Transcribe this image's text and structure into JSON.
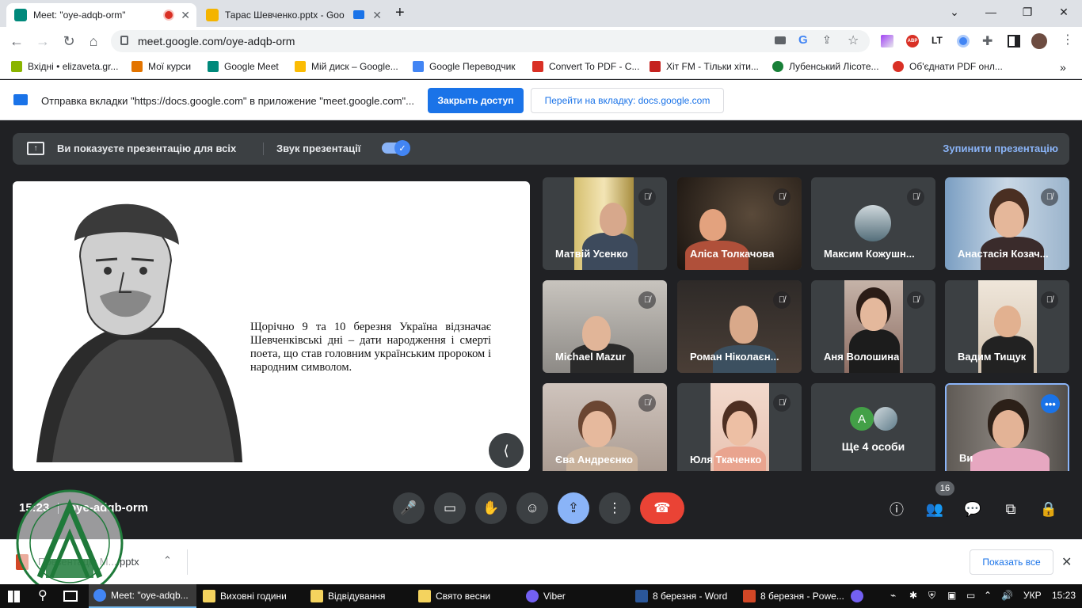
{
  "browser": {
    "tabs": [
      {
        "title": "Meet: \"oye-adqb-orm\"",
        "active": true,
        "fav_color": "#00897b"
      },
      {
        "title": "Тарас Шевченко.pptx - Goo",
        "active": false,
        "fav_color": "#f4b400"
      }
    ],
    "new_tab": "+",
    "url": "meet.google.com/oye-adqb-orm",
    "bookmarks": [
      {
        "label": "Вхідні • elizaveta.gr...",
        "color": "#8ab400"
      },
      {
        "label": "Мої курси",
        "color": "#e37400"
      },
      {
        "label": "Google Meet",
        "color": "#00897b"
      },
      {
        "label": "Мій диск – Google...",
        "color": "#fbbc04"
      },
      {
        "label": "Google Переводчик",
        "color": "#4285f4"
      },
      {
        "label": "Convert To PDF - C...",
        "color": "#d93025"
      },
      {
        "label": "Хіт FM - Тільки хіти...",
        "color": "#c5221f"
      },
      {
        "label": "Лубенський Лісоте...",
        "color": "#188038"
      },
      {
        "label": "Об'єднати PDF онл...",
        "color": "#d93025"
      }
    ],
    "bookmarks_more": "»"
  },
  "infobar": {
    "message": "Отправка вкладки \"https://docs.google.com\" в приложение \"meet.google.com\"...",
    "primary_button": "Закрыть доступ",
    "secondary_button": "Перейти на вкладку: docs.google.com"
  },
  "presenting_bar": {
    "status": "Ви показуєте презентацію для всіх",
    "audio_label": "Звук презентації",
    "stop_label": "Зупинити презентацію"
  },
  "slide": {
    "text": "Щорічно 9 та 10 березня Україна відзначає Шевченківські дні – дати народження і смерті поета, що став головним українським пророком і народним символом."
  },
  "participants": [
    {
      "name": "Матвій Усенко"
    },
    {
      "name": "Аліса Толкачова"
    },
    {
      "name": "Максим Кожушн..."
    },
    {
      "name": "Анастасія Козач..."
    },
    {
      "name": "Michael Mazur"
    },
    {
      "name": "Роман Ніколаєн..."
    },
    {
      "name": "Аня Волошина"
    },
    {
      "name": "Вадим Тищук"
    },
    {
      "name": "Єва Андреєнко"
    },
    {
      "name": "Юля Ткаченко"
    },
    {
      "name": "Ще 4 особи",
      "avatar_letter": "A"
    },
    {
      "name": "Ви"
    }
  ],
  "bottom": {
    "time": "15:23",
    "meeting_code": "oye-adqb-orm",
    "people_count": "16"
  },
  "download": {
    "file": "Презентація М....pptx",
    "show_all": "Показать все"
  },
  "taskbar": {
    "items": [
      {
        "label": "Meet: \"oye-adqb...",
        "active": true,
        "color": "#4285f4"
      },
      {
        "label": "Виховні години",
        "active": false,
        "color": "#f4d35e"
      },
      {
        "label": "Відвідування",
        "active": false,
        "color": "#f4d35e"
      },
      {
        "label": "Свято весни",
        "active": false,
        "color": "#f4d35e"
      },
      {
        "label": "Viber",
        "active": false,
        "color": "#7360f2"
      },
      {
        "label": "8 березня - Word",
        "active": false,
        "color": "#2b579a"
      },
      {
        "label": "8 березня - Powe...",
        "active": false,
        "color": "#d24726"
      }
    ],
    "lang": "УКР",
    "clock": "15:23"
  },
  "colors": {
    "meet_bg": "#202124",
    "accent": "#1a73e8",
    "end_call": "#ea4335",
    "highlight": "#8ab4f8"
  }
}
